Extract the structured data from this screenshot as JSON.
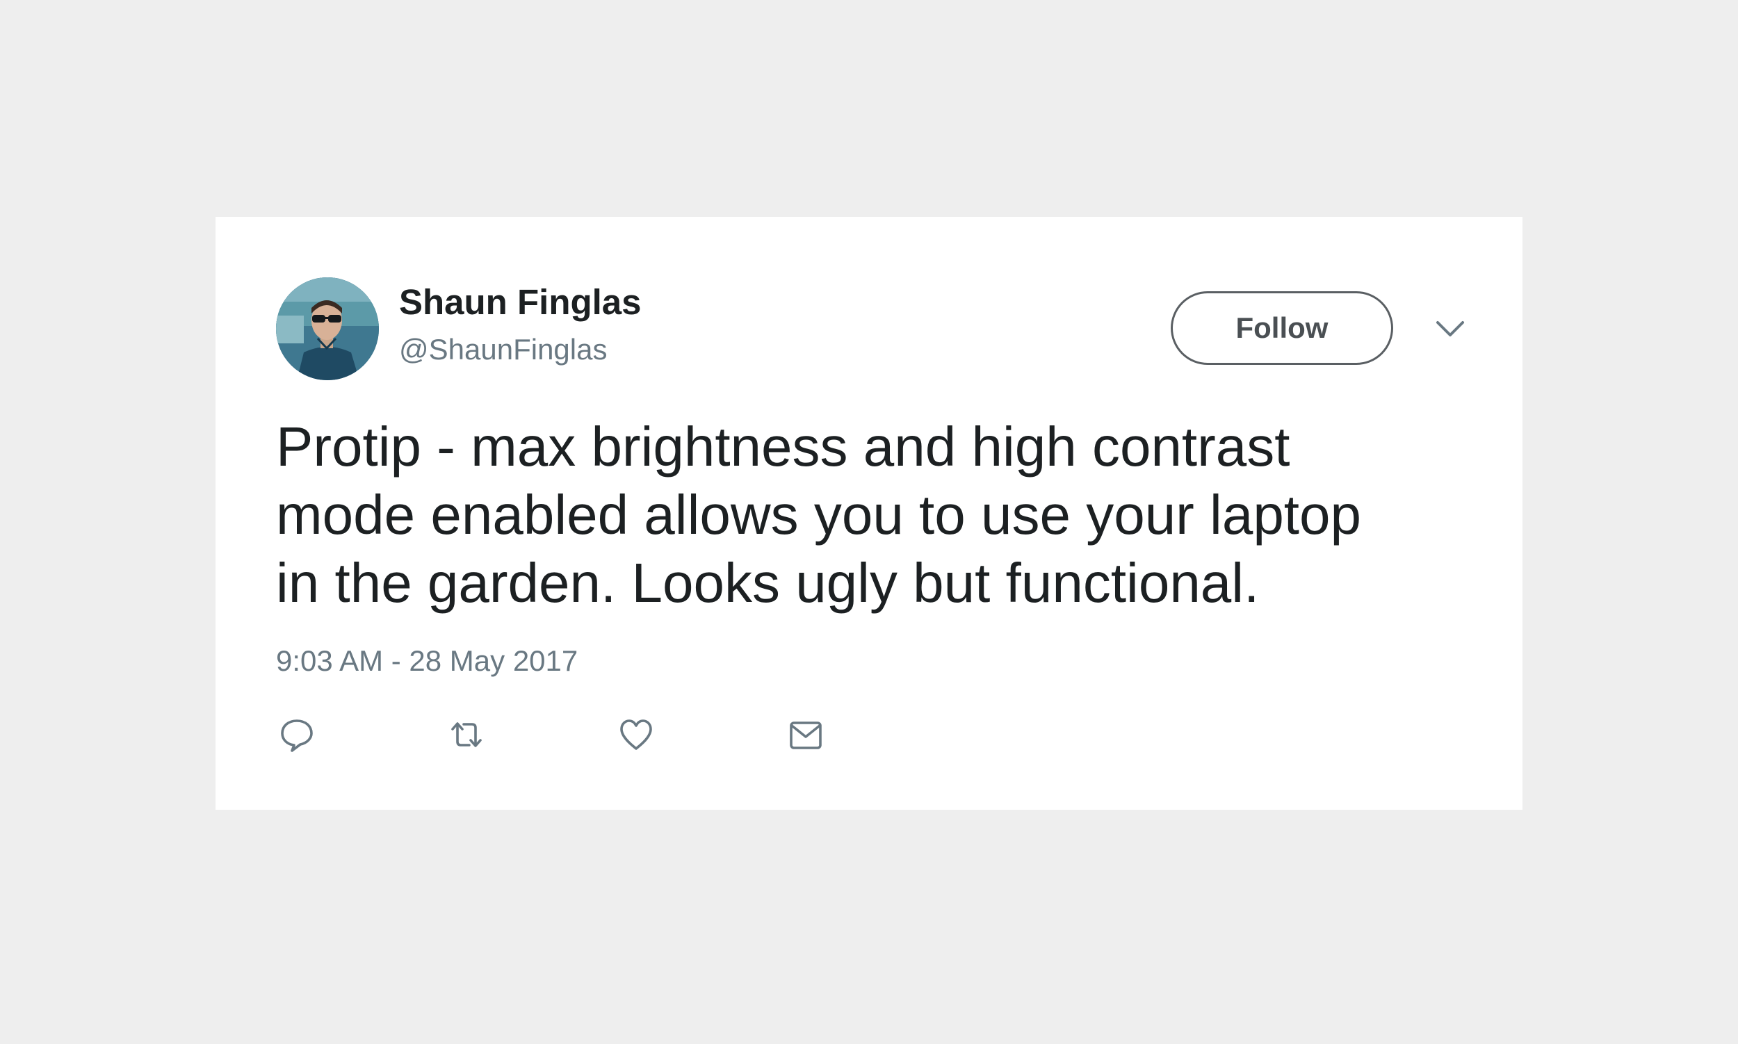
{
  "tweet": {
    "author": {
      "display_name": "Shaun Finglas",
      "handle": "@ShaunFinglas"
    },
    "follow_label": "Follow",
    "text": "Protip - max brightness and high contrast\nmode enabled allows you to use your laptop\nin the garden. Looks ugly but functional.",
    "timestamp": "9:03 AM - 28 May 2017",
    "icons": {
      "menu": "chevron-down-icon",
      "reply": "reply-icon",
      "retweet": "retweet-icon",
      "like": "heart-icon",
      "direct_message": "envelope-icon"
    }
  },
  "colors": {
    "background": "#eeeeee",
    "card": "#ffffff",
    "text_primary": "#1c2022",
    "text_secondary": "#697882",
    "icon": "#697882"
  }
}
